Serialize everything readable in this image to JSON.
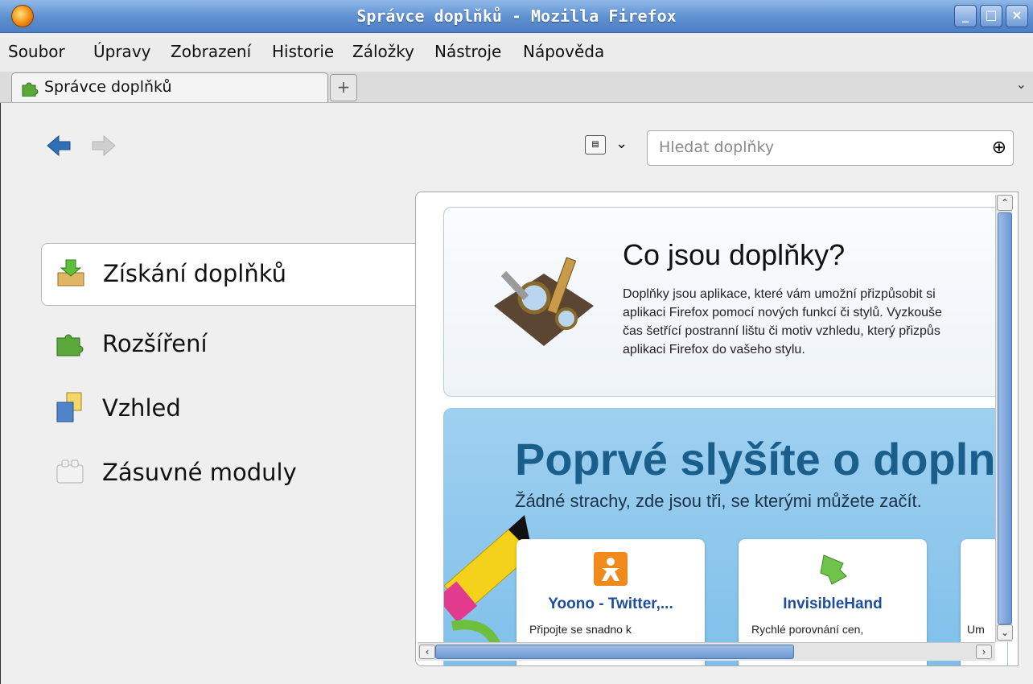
{
  "window": {
    "title": "Správce doplňků - Mozilla Firefox"
  },
  "menubar": {
    "items": [
      "Soubor",
      "Úpravy",
      "Zobrazení",
      "Historie",
      "Záložky",
      "Nástroje",
      "Nápověda"
    ]
  },
  "tab": {
    "label": "Správce doplňků"
  },
  "search": {
    "placeholder": "Hledat doplňky"
  },
  "categories": [
    "Získání doplňků",
    "Rozšíření",
    "Vzhled",
    "Zásuvné moduly"
  ],
  "intro": {
    "title": "Co jsou doplňky?",
    "lines": [
      "Doplňky jsou aplikace, které vám umožní přizpůsobit si",
      "aplikaci Firefox pomocí nových funkcí či stylů. Vyzkouše",
      "čas šetřící postranní lištu či motiv vzhledu, který přizpůs",
      "aplikaci Firefox do vašeho stylu."
    ]
  },
  "promo": {
    "heading": "Poprvé slyšíte o dopln",
    "subheading": "Žádné strachy, zde jsou tři, se kterými můžete začít.",
    "addons": [
      {
        "name": "Yoono - Twitter,...",
        "desc": "Připojte se snadno k"
      },
      {
        "name": "InvisibleHand",
        "desc": "Rychlé porovnání cen,"
      },
      {
        "name": "",
        "desc": "Um"
      }
    ]
  },
  "colors": {
    "titlebar": "#5d8fd0",
    "accent": "#1a5f8c",
    "link": "#1f4e9a"
  }
}
